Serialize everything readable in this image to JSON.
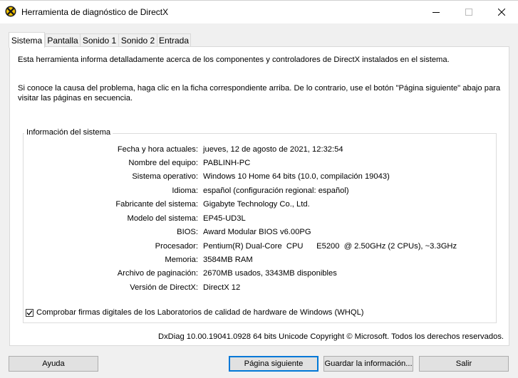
{
  "window": {
    "title": "Herramienta de diagnóstico de DirectX",
    "icon": "directx-x-icon",
    "accent": "#0078d7"
  },
  "tabs": [
    {
      "label": "Sistema",
      "active": true
    },
    {
      "label": "Pantalla",
      "active": false
    },
    {
      "label": "Sonido 1",
      "active": false
    },
    {
      "label": "Sonido 2",
      "active": false
    },
    {
      "label": "Entrada",
      "active": false
    }
  ],
  "intro": {
    "line1": "Esta herramienta informa detalladamente acerca de los componentes y controladores de DirectX instalados en el sistema.",
    "line2": "Si conoce la causa del problema, haga clic en la ficha correspondiente arriba. De lo contrario, use el botón \"Página siguiente\" abajo para visitar las páginas en secuencia."
  },
  "system_info": {
    "title": "Información del sistema",
    "rows": [
      {
        "label": "Fecha y hora actuales:",
        "value": "jueves, 12 de agosto de 2021, 12:32:54"
      },
      {
        "label": "Nombre del equipo:",
        "value": "PABLINH-PC"
      },
      {
        "label": "Sistema operativo:",
        "value": "Windows 10 Home 64 bits (10.0, compilación 19043)"
      },
      {
        "label": "Idioma:",
        "value": "español (configuración regional: español)"
      },
      {
        "label": "Fabricante del sistema:",
        "value": "Gigabyte Technology Co., Ltd."
      },
      {
        "label": "Modelo del sistema:",
        "value": "EP45-UD3L"
      },
      {
        "label": "BIOS:",
        "value": "Award Modular BIOS v6.00PG"
      },
      {
        "label": "Procesador:",
        "value": "Pentium(R) Dual-Core  CPU      E5200  @ 2.50GHz (2 CPUs), ~3.3GHz"
      },
      {
        "label": "Memoria:",
        "value": "3584MB RAM"
      },
      {
        "label": "Archivo de paginación:",
        "value": "2670MB usados, 3343MB disponibles"
      },
      {
        "label": "Versión de DirectX:",
        "value": "DirectX 12"
      }
    ]
  },
  "whql": {
    "label": "Comprobar firmas digitales de los Laboratorios de calidad de hardware de Windows (WHQL)",
    "checked": true
  },
  "version_text": "DxDiag 10.00.19041.0928 64 bits Unicode  Copyright © Microsoft. Todos los derechos reservados.",
  "buttons": {
    "help": "Ayuda",
    "next": "Página siguiente",
    "save": "Guardar la información...",
    "exit": "Salir"
  }
}
